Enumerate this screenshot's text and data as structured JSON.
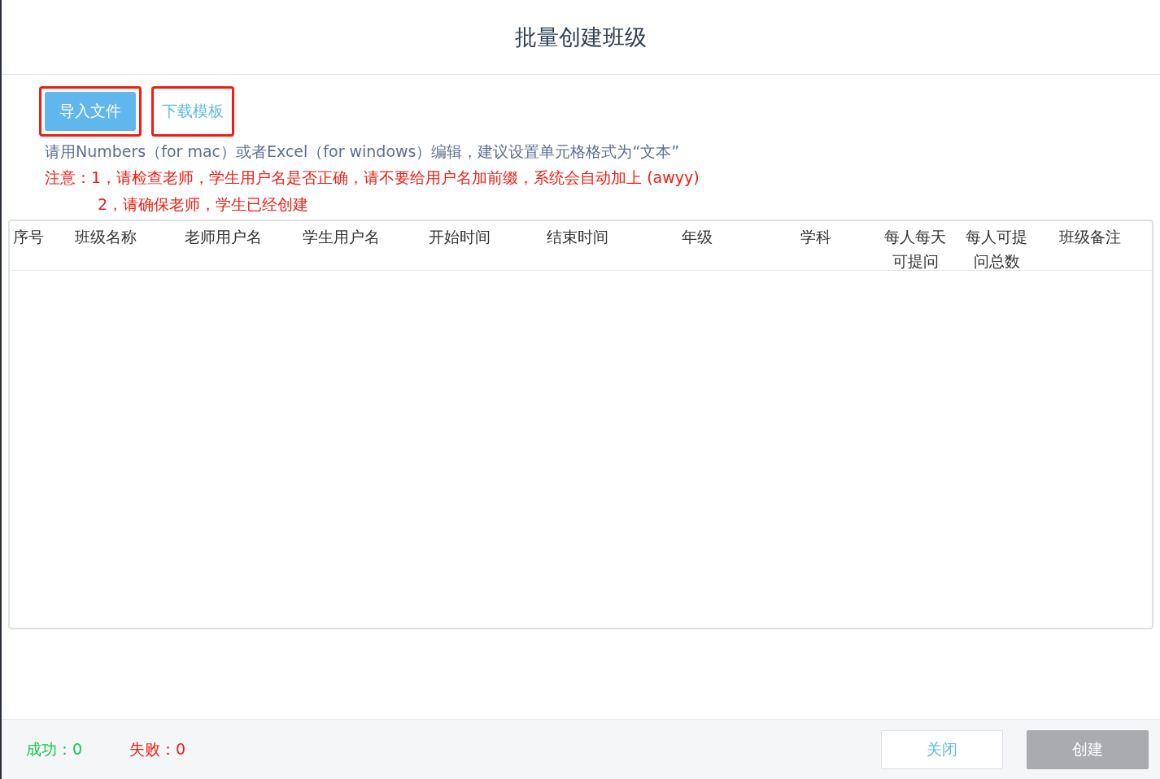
{
  "dialog": {
    "title": "批量创建班级"
  },
  "actions": [
    {
      "kind": "primary",
      "label": "导入文件",
      "highlighted": true
    },
    {
      "kind": "link",
      "label": "下载模板",
      "highlighted": true
    }
  ],
  "hint": "请用Numbers（for mac）或者Excel（for windows）编辑，建议设置单元格格式为“文本”",
  "notes": [
    "注意：1，请检查老师，学生用户名是否正确，请不要给用户名加前缀，系统会自动加上 (awyy)",
    "2，请确保老师，学生已经创建"
  ],
  "table": {
    "columns": [
      "序号",
      "班级名称",
      "老师用户名",
      "学生用户名",
      "开始时间",
      "结束时间",
      "年级",
      "学科",
      "每人每天可提问",
      "每人可提问总数",
      "班级备注"
    ]
  },
  "footer": {
    "success": "成功：0",
    "failure": "失败：0",
    "buttons": [
      {
        "label": "关闭",
        "disabled": false
      },
      {
        "label": "创建",
        "disabled": true
      }
    ]
  }
}
